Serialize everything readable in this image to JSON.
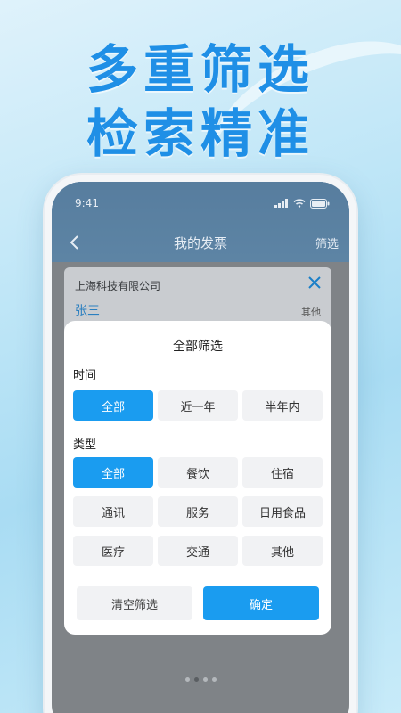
{
  "hero": {
    "line1": "多重筛选",
    "line2": "检索精准"
  },
  "status": {
    "time": "9:41",
    "icons": [
      "signal-icon",
      "wifi-icon",
      "battery-icon"
    ]
  },
  "navbar": {
    "title": "我的发票",
    "filter_label": "筛选",
    "back_icon": "chevron-left-icon"
  },
  "invoice": {
    "company": "上海科技有限公司",
    "name": "张三",
    "tag": "其他",
    "close_icon": "close-icon"
  },
  "filter_sheet": {
    "title": "全部筛选",
    "time_label": "时间",
    "time_options": [
      "全部",
      "近一年",
      "半年内"
    ],
    "time_selected": "全部",
    "type_label": "类型",
    "type_options": [
      "全部",
      "餐饮",
      "住宿",
      "通讯",
      "服务",
      "日用食品",
      "医疗",
      "交通",
      "其他"
    ],
    "type_selected": "全部",
    "clear_label": "清空筛选",
    "confirm_label": "确定"
  },
  "pager": {
    "count": 4,
    "active_index": 1
  },
  "colors": {
    "accent": "#1a9cf0",
    "hero_text": "#1f8fe6",
    "header_blue": "#2f7fc4"
  }
}
